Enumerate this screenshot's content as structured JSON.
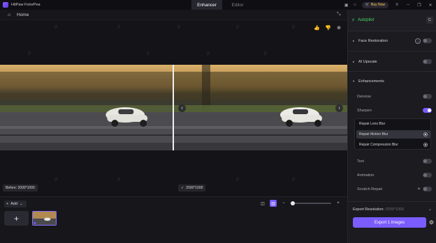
{
  "titlebar": {
    "app_name": "HitPaw FotorPea",
    "tabs": [
      {
        "label": "Enhancer",
        "active": true
      },
      {
        "label": "Editor",
        "active": false
      }
    ],
    "buy_label": "Buy Now"
  },
  "homebar": {
    "label": "Home"
  },
  "canvas": {
    "before_label": "Before: 2000*1000",
    "after_label": "2000*1000"
  },
  "bottom": {
    "add_label": "Add",
    "zoom_level": 0.0
  },
  "panel": {
    "autopilot_label": "Autopilot",
    "c_label": "C",
    "face_restoration": {
      "label": "Face Restoration",
      "enabled": false
    },
    "ai_upscale": {
      "label": "AI Upscale",
      "enabled": false
    },
    "enhancements_label": "Enhancements",
    "denoise": {
      "label": "Denoise",
      "enabled": false
    },
    "sharpen": {
      "label": "Sharpen",
      "enabled": true
    },
    "sharpen_options": [
      {
        "label": "Repair Lens Blur",
        "selected": false
      },
      {
        "label": "Repair Motion Blur",
        "selected": true
      },
      {
        "label": "Repair Compression Blur",
        "selected": false
      }
    ],
    "text": {
      "label": "Text",
      "enabled": false
    },
    "animation": {
      "label": "Animation",
      "enabled": false
    },
    "scratch_repair": {
      "label": "Scratch Repair",
      "enabled": false
    },
    "export_resolution_label": "Export Resolution:",
    "export_resolution_value": "2000*1000",
    "export_button": "Export 1 images"
  },
  "colors": {
    "accent": "#7a5cff",
    "autopilot_green": "#4cd964",
    "buy_yellow": "#ffd34d"
  }
}
